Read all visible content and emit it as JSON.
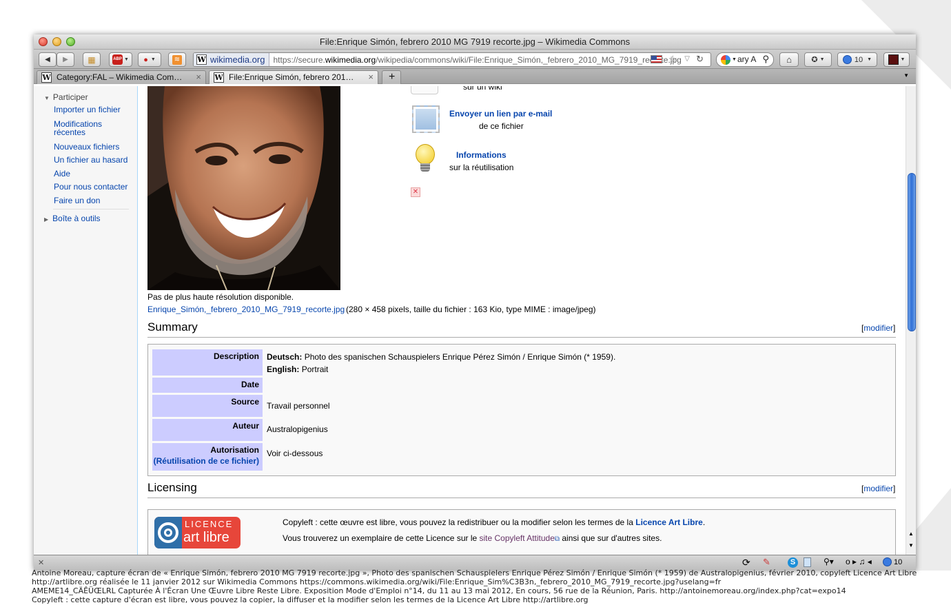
{
  "window": {
    "title": "File:Enrique Simón, febrero 2010 MG 7919 recorte.jpg – Wikimedia Commons"
  },
  "toolbar": {
    "identity": "wikimedia.org",
    "url_prefix": "https://secure.",
    "url_domain": "wikimedia.org",
    "url_path": "/wikipedia/commons/wiki/File:Enrique_Simón,_febrero_2010_MG_7919_recorte.jpg",
    "search_text": "ary A",
    "counter": "10",
    "abp_label": "ABP"
  },
  "tabs": [
    {
      "label": "Category:FAL – Wikimedia Com…",
      "active": false
    },
    {
      "label": "File:Enrique Simón, febrero 201…",
      "active": true
    }
  ],
  "sidebar": {
    "participer": "Participer",
    "links": [
      "Importer un fichier",
      "Modifications",
      "récentes",
      "Nouveaux fichiers",
      "Un fichier au hasard",
      "Aide",
      "Pour nous contacter",
      "Faire un don"
    ],
    "toolbox": "Boîte à outils"
  },
  "actions": {
    "partial": "sur un wiki",
    "email_title": "Envoyer un lien par e-mail",
    "email_sub": "de ce fichier",
    "info_title": "Informations",
    "info_sub": "sur la réutilisation"
  },
  "file": {
    "no_higher": "Pas de plus haute résolution disponible.",
    "name": "Enrique_Simón,_febrero_2010_MG_7919_recorte.jpg",
    "details": "(280 × 458 pixels, taille du fichier : 163 Kio, type MIME : image/jpeg)"
  },
  "summary": {
    "heading": "Summary",
    "edit": "modifier",
    "rows": {
      "description": "Description",
      "date": "Date",
      "source": "Source",
      "auteur": "Auteur",
      "autorisation": "Autorisation",
      "reuse": "(Réutilisation de ce fichier)"
    },
    "desc_de_label": "Deutsch:",
    "desc_de": "Photo des spanischen Schauspielers Enrique Pérez Simón / Enrique Simón (* 1959).",
    "desc_en_label": "English:",
    "desc_en": "Portrait",
    "source_val": "Travail personnel",
    "auteur_val": "Australopigenius",
    "autorisation_val": "Voir ci-dessous"
  },
  "licensing": {
    "heading": "Licensing",
    "edit": "modifier",
    "logo_top": "LICENCE",
    "logo_bottom": "art libre",
    "line1_pre": "Copyleft : cette œuvre est libre, vous pouvez la redistribuer ou la modifier selon les termes de la ",
    "line1_link": "Licence Art Libre",
    "line1_post": ".",
    "line2_pre": "Vous trouverez un exemplaire de cette Licence sur le ",
    "line2_link": "site Copyleft Attitude",
    "line2_post": " ainsi que sur d'autres sites."
  },
  "statusbar": {
    "counter": "10"
  },
  "caption": [
    "Antoine Moreau, capture écran de « Enrique Simón, febrero 2010 MG 7919 recorte.jpg », Photo des spanischen Schauspielers Enrique Pérez Simón / Enrique Simón (* 1959) de Australopigenius, février 2010, copyleft Licence Art Libre",
    "http://artlibre.org réalisée le 11 janvier 2012 sur Wikimedia Commons https://commons.wikimedia.org/wiki/File:Enrique_Sim%C3B3n,_febrero_2010_MG_7919_recorte.jpg?uselang=fr",
    "AMEME14_CÄÊÜŒLRL Capturée À l'Écran Une Œuvre Libre Reste Libre. Exposition Mode d'Emploi n°14, du 11 au 13 mai 2012, En cours, 56 rue de la Réunion, Paris. http://antoinemoreau.org/index.php?cat=expo14",
    "Copyleft : cette capture d'écran est libre, vous pouvez la copier, la diffuser et la modifier selon les termes de la Licence Art Libre http://artlibre.org"
  ],
  "colors": {
    "link": "#0645ad",
    "redlink": "#a55858",
    "table_label": "#ccccff",
    "scroll_thumb": "#2f6fd6"
  }
}
